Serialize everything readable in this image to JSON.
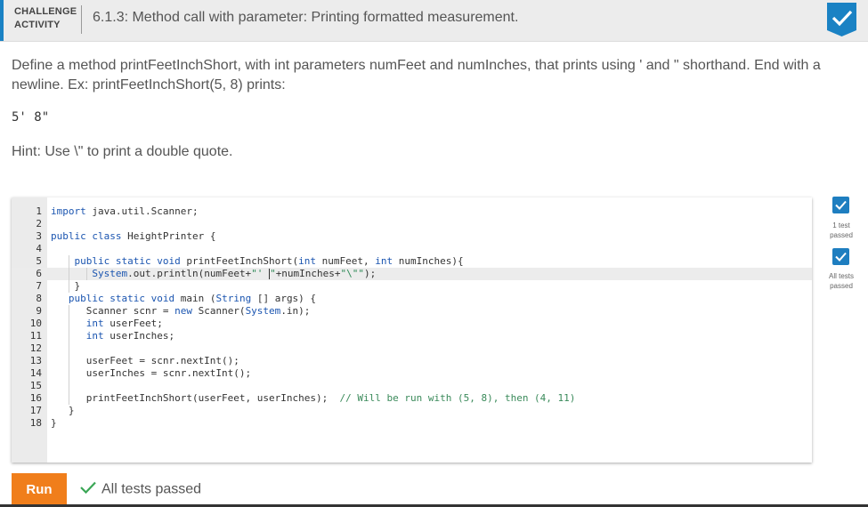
{
  "header": {
    "label_line1": "CHALLENGE",
    "label_line2": "ACTIVITY",
    "title": "6.1.3: Method call with parameter: Printing formatted measurement.",
    "badge_icon": "checkmark-icon"
  },
  "prompt": {
    "text": "Define a method printFeetInchShort, with int parameters numFeet and numInches, that prints using ' and \" shorthand. End with a newline. Ex: printFeetInchShort(5, 8) prints:",
    "example_output": "5' 8\"",
    "hint": "Hint: Use \\\" to print a double quote."
  },
  "editor": {
    "line_numbers": [
      "1",
      "2",
      "3",
      "4",
      "5",
      "6",
      "7",
      "8",
      "9",
      "10",
      "11",
      "12",
      "13",
      "14",
      "15",
      "16",
      "17",
      "18"
    ],
    "active_line": 6
  },
  "tests": [
    {
      "icon": "checkmark-icon",
      "line1": "1 test",
      "line2": "passed"
    },
    {
      "icon": "checkmark-icon",
      "line1": "All tests",
      "line2": "passed"
    }
  ],
  "run": {
    "button_label": "Run",
    "result_text": "All tests passed"
  },
  "colors": {
    "accent_blue": "#1a82c4",
    "run_orange": "#f07e1b",
    "check_green": "#3aa655",
    "keyword_blue": "#1b55b0",
    "string_green": "#2e8a57"
  }
}
